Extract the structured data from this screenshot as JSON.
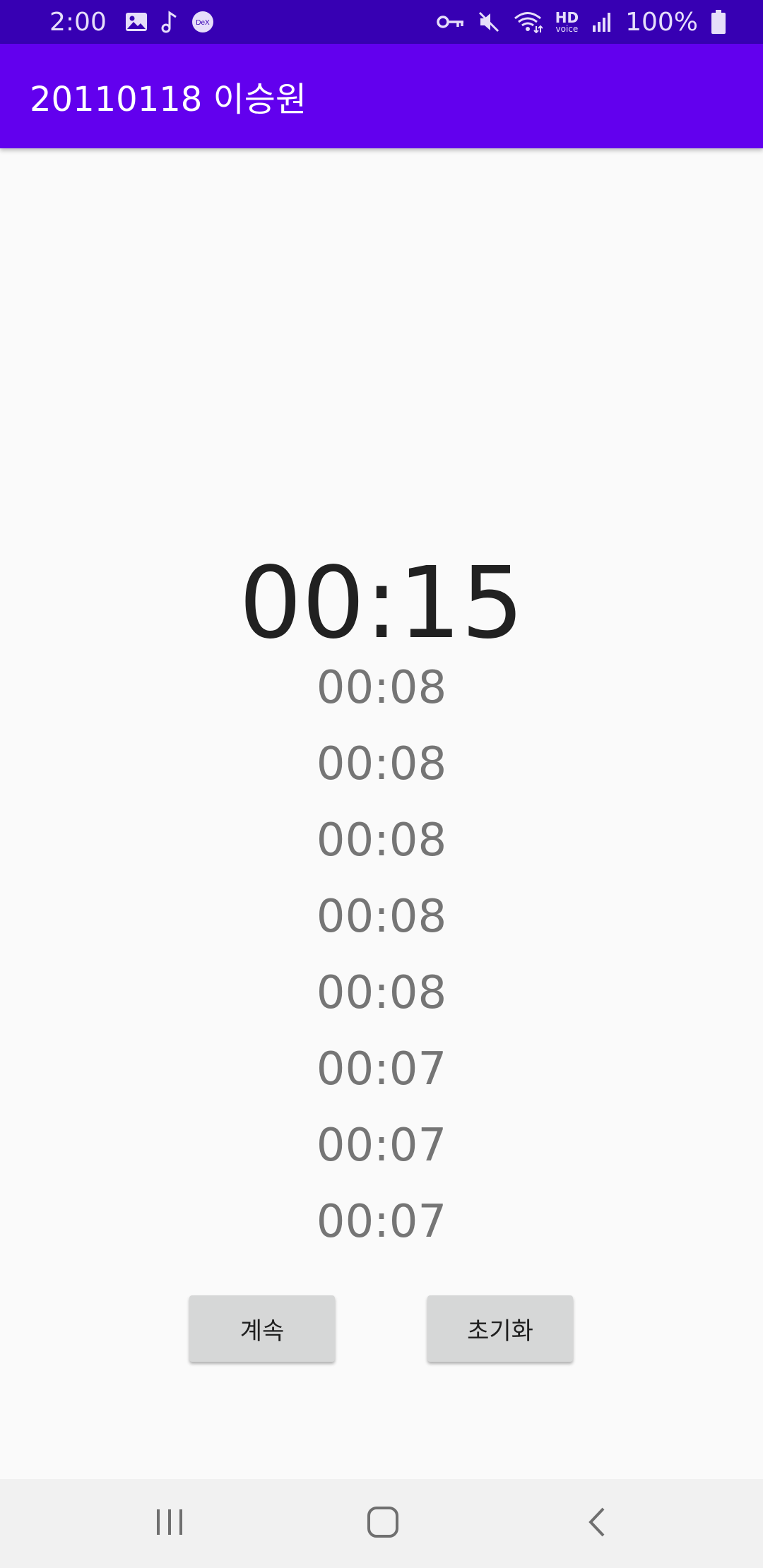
{
  "status_bar": {
    "time": "2:00",
    "icons_left": [
      "image-icon",
      "music-note-icon",
      "dex-icon"
    ],
    "dex_label": "DeX",
    "icons_right": [
      "vpn-key-icon",
      "mute-icon",
      "wifi-icon",
      "hd-voice-icon",
      "signal-icon",
      "battery-icon"
    ],
    "hd_label": "HD",
    "voice_label": "voice",
    "battery": "100%"
  },
  "app_bar": {
    "title": "20110118 이승원"
  },
  "stopwatch": {
    "current_time": "00:15",
    "laps": [
      "00:08",
      "00:08",
      "00:08",
      "00:08",
      "00:08",
      "00:07",
      "00:07",
      "00:07"
    ]
  },
  "buttons": {
    "continue_label": "계속",
    "reset_label": "초기화"
  },
  "nav_bar": {
    "icons": [
      "recents-icon",
      "home-icon",
      "back-icon"
    ]
  },
  "colors": {
    "status_bar": "#3700b3",
    "app_bar": "#6200ee",
    "background": "#fafafa",
    "button": "#d6d7d7",
    "lap_text": "#757575",
    "time_text": "#212121",
    "nav_bar": "#f1f1f1"
  }
}
